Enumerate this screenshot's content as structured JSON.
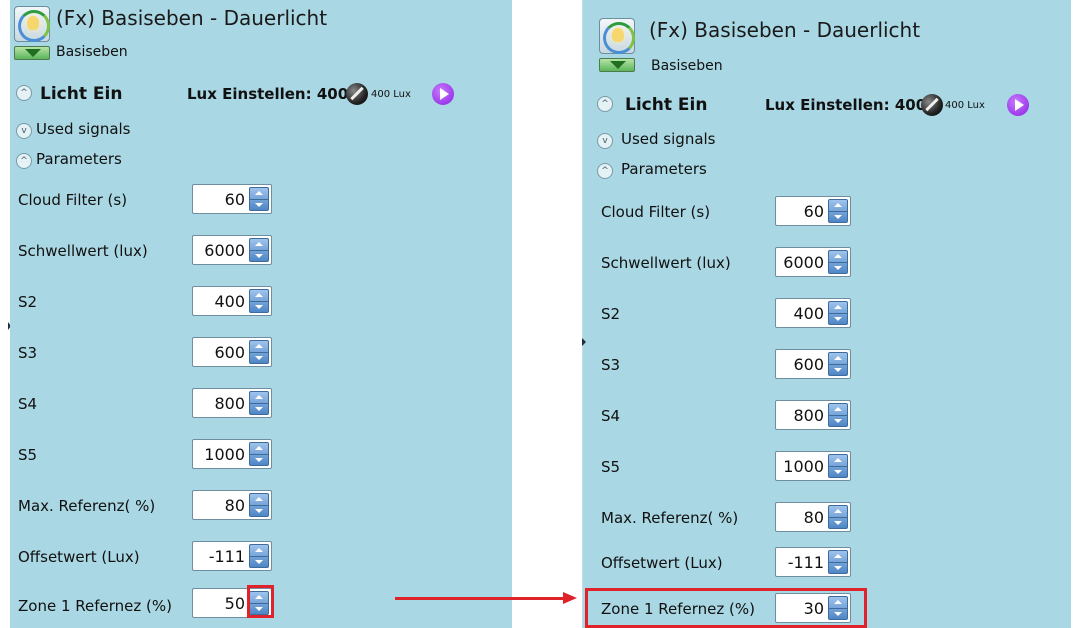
{
  "panels": [
    {
      "title": "(Fx) Basiseben - Dauerlicht",
      "subtitle": "Basiseben",
      "licht_label": "Licht Ein",
      "lux_label": "Lux Einstellen: 400",
      "lux_small": "400 Lux",
      "used_signals": "Used signals",
      "parameters": "Parameters",
      "params": [
        {
          "label": "Cloud Filter (s)",
          "value": "60"
        },
        {
          "label": "Schwellwert (lux)",
          "value": "6000"
        },
        {
          "label": "S2",
          "value": "400"
        },
        {
          "label": "S3",
          "value": "600"
        },
        {
          "label": "S4",
          "value": "800"
        },
        {
          "label": "S5",
          "value": "1000"
        },
        {
          "label": "Max. Referenz( %)",
          "value": "80"
        },
        {
          "label": "Offsetwert (Lux)",
          "value": "-111"
        },
        {
          "label": "Zone 1 Refernez (%)",
          "value": "50"
        }
      ]
    },
    {
      "title": "(Fx) Basiseben - Dauerlicht",
      "subtitle": "Basiseben",
      "licht_label": "Licht Ein",
      "lux_label": "Lux Einstellen: 400",
      "lux_small": "400 Lux",
      "used_signals": "Used signals",
      "parameters": "Parameters",
      "params": [
        {
          "label": "Cloud Filter (s)",
          "value": "60"
        },
        {
          "label": "Schwellwert (lux)",
          "value": "6000"
        },
        {
          "label": "S2",
          "value": "400"
        },
        {
          "label": "S3",
          "value": "600"
        },
        {
          "label": "S4",
          "value": "800"
        },
        {
          "label": "S5",
          "value": "1000"
        },
        {
          "label": "Max. Referenz( %)",
          "value": "80"
        },
        {
          "label": "Offsetwert (Lux)",
          "value": "-111"
        },
        {
          "label": "Zone 1 Refernez (%)",
          "value": "30"
        }
      ]
    }
  ],
  "colors": {
    "panel_background": "#a9d7e3",
    "highlight": "#e0222a",
    "spin_button": "#4e86c6",
    "play_button": "#8a1fe0"
  },
  "icons": {
    "app": "lightbulb-refresh-icon",
    "expand": "chevron-down-icon",
    "collapse": "chevron-up-icon",
    "knob": "dial-icon",
    "play": "play-icon",
    "arrow": "arrow-right-icon"
  }
}
